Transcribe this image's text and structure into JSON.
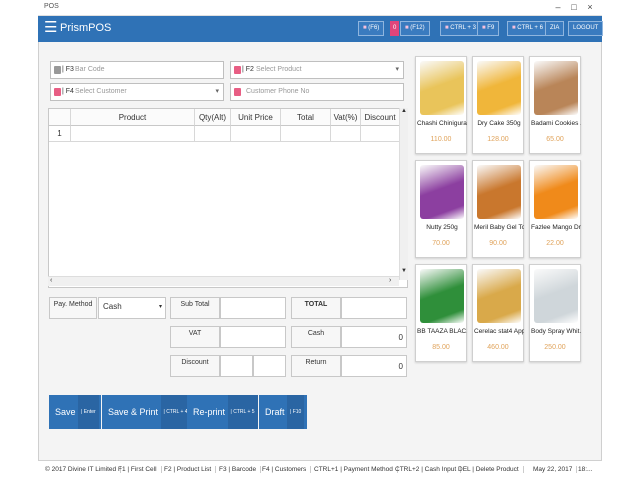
{
  "window": {
    "title": "POS",
    "minimize": "–",
    "maximize": "□",
    "close": "×"
  },
  "app": {
    "name": "PrismPOS",
    "menu_icon": "hamburger-icon"
  },
  "header": {
    "f6": "(F6)",
    "f6_badge": "0",
    "f12": "(F12)",
    "ctrl3": "CTRL + 3",
    "f9": "F9",
    "ctrl6": "CTRL + 6",
    "user": "ZIA",
    "logout": "LOGOUT"
  },
  "inputs": {
    "barcode_key": "F3",
    "barcode_placeholder": "Bar Code",
    "product_key": "F2",
    "product_placeholder": "Select Product",
    "customer_key": "F4",
    "customer_placeholder": "Select Customer",
    "phone_placeholder": "Customer Phone No"
  },
  "grid": {
    "columns": [
      "Product",
      "Qty(Alt)",
      "Unit Price",
      "Total",
      "Vat(%)",
      "Discount"
    ],
    "rows": [
      [
        "1",
        "",
        "",
        "",
        "",
        "",
        ""
      ]
    ]
  },
  "payment": {
    "pay_method_label": "Pay. Method",
    "pay_method_value": "Cash",
    "subtotal_label": "Sub Total",
    "vat_label": "VAT",
    "discount_label": "Discount",
    "total_label": "TOTAL",
    "cash_label": "Cash",
    "cash_value": "0",
    "return_label": "Return",
    "return_value": "0"
  },
  "actions": [
    {
      "label": "Save",
      "shortcut": "| Enter"
    },
    {
      "label": "Save & Print",
      "shortcut": "| CTRL + 4"
    },
    {
      "label": "Re-print",
      "shortcut": "| CTRL + 5"
    },
    {
      "label": "Draft",
      "shortcut": "| F10"
    }
  ],
  "products": [
    {
      "name": "Chashi Chinigura ...",
      "price": "110.00",
      "color": "#e9c45a"
    },
    {
      "name": "Dry Cake 350g",
      "price": "128.00",
      "color": "#f0b63a"
    },
    {
      "name": "Badami Cookies ...",
      "price": "65.00",
      "color": "#b98558"
    },
    {
      "name": "Nutty 250g",
      "price": "70.00",
      "color": "#8c3fa0"
    },
    {
      "name": "Meril Baby Gel To...",
      "price": "90.00",
      "color": "#c9772d"
    },
    {
      "name": "Fazlee Mango Dri...",
      "price": "22.00",
      "color": "#f08a1a"
    },
    {
      "name": "BB TAAZA BLAC...",
      "price": "85.00",
      "color": "#2f8f3a"
    },
    {
      "name": "Cerelac stat4 Appl...",
      "price": "460.00",
      "color": "#d9a94a"
    },
    {
      "name": "Body Spray Whit...",
      "price": "250.00",
      "color": "#cfd6da"
    }
  ],
  "status": [
    "© 2017 Divine IT Limited",
    "F1 | First Cell",
    "F2 | Product List",
    "F3 | Barcode",
    "F4 | Customers",
    "CTRL+1 | Payment Method",
    "CTRL+2 | Cash Input",
    "DEL | Delete Product",
    "May 22, 2017",
    "18:..."
  ]
}
